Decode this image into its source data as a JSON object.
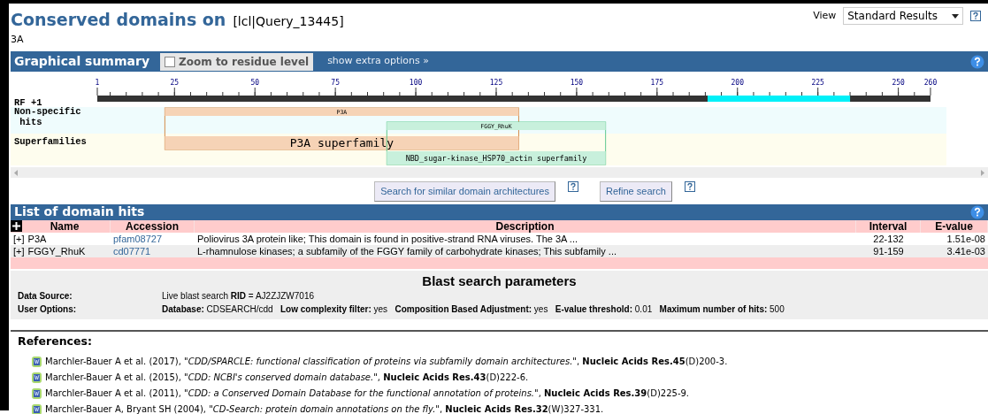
{
  "title": "Conserved domains on",
  "query": "[lcl|Query_13445]",
  "subtitle": "3A",
  "view": {
    "label": "View",
    "value": "Standard Results"
  },
  "graphical_summary": {
    "title": "Graphical summary",
    "zoom_checkbox": {
      "label": "Zoom to residue level",
      "checked": false
    },
    "extra_options": "show extra options »",
    "ruler": {
      "label": "RF +1",
      "ticks": [
        "1",
        "25",
        "50",
        "75",
        "100",
        "125",
        "150",
        "175",
        "200",
        "225",
        "250",
        "260"
      ]
    },
    "track_labels": [
      "Non-specific hits",
      "Superfamilies"
    ],
    "domains": [
      {
        "label": "P3A",
        "superfamily": "P3A superfamily",
        "color": "#f6d3b6"
      },
      {
        "label": "FGGY_RhuK",
        "superfamily": "NBD_sugar-kinase_HSP70_actin superfamily",
        "color": "#c8f0dc"
      }
    ]
  },
  "buttons": [
    "Search for similar domain architectures",
    "Refine search"
  ],
  "hits": {
    "title": "List of domain hits",
    "columns": [
      "Name",
      "Accession",
      "Description",
      "Interval",
      "E-value"
    ],
    "rows": [
      {
        "expander": "[+]",
        "name": "P3A",
        "accession": "pfam08727",
        "description": "Poliovirus 3A protein like; This domain is found in positive-strand RNA viruses. The 3A ...",
        "interval": "22-132",
        "evalue": "1.51e-08"
      },
      {
        "expander": "[+]",
        "name": "FGGY_RhuK",
        "accession": "cd07771",
        "description": "L-rhamnulose kinases; a subfamily of the FGGY family of carbohydrate kinases; This subfamily ...",
        "interval": "91-159",
        "evalue": "3.41e-03"
      }
    ]
  },
  "blast": {
    "title": "Blast search parameters",
    "params": [
      {
        "label": "Data Source:",
        "text": "Live blast search **RID** = AJ2ZJZW7016"
      },
      {
        "label": "User Options:",
        "text": "**Database:** CDSEARCH/cdd   **Low complexity filter:** yes   **Composition Based Adjustment:** yes   **E-value threshold:** 0.01   **Maximum number of hits:** 500"
      }
    ]
  },
  "references": {
    "title": "References:",
    "items": [
      "Marchler-Bauer A et al. (2017), *\"CDD/SPARCLE: functional classification of proteins via subfamily domain architectures.\"*, **Nucleic Acids Res.45**(D)200-3.",
      "Marchler-Bauer A et al. (2015), *\"CDD: NCBI's conserved domain database.\"*, **Nucleic Acids Res.43**(D)222-6.",
      "Marchler-Bauer A et al. (2011), *\"CDD: a Conserved Domain Database for the functional annotation of proteins.\"*, **Nucleic Acids Res.39**(D)225-9.",
      "Marchler-Bauer A, Bryant SH (2004), *\"CD-Search: protein domain annotations on the fly.\"*, **Nucleic Acids Res.32**(W)327-331."
    ]
  }
}
